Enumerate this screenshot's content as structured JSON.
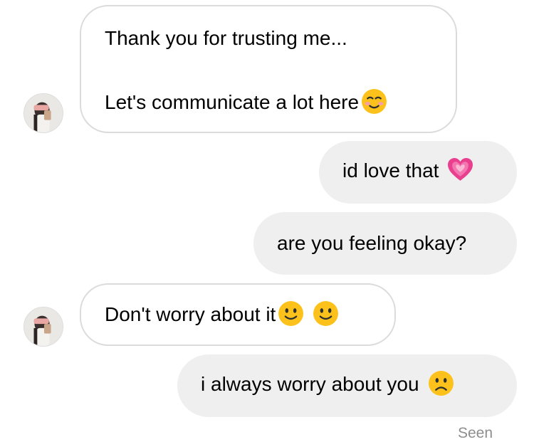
{
  "conversation": {
    "messages": [
      {
        "from": "them",
        "lines": [
          "Thank you for trusting me...",
          "Let's communicate a lot here"
        ],
        "emojis": [
          "smiling-face-icon"
        ]
      },
      {
        "from": "me",
        "text": "id love that",
        "emojis": [
          "growing-heart-icon"
        ]
      },
      {
        "from": "me",
        "text": "are you feeling okay?",
        "emojis": []
      },
      {
        "from": "them",
        "text": "Don't worry about it",
        "emojis": [
          "slightly-smiling-face-icon",
          "slightly-smiling-face-icon"
        ]
      },
      {
        "from": "me",
        "text": "i always worry about you",
        "emojis": [
          "frowning-face-icon"
        ]
      }
    ],
    "status": "Seen"
  },
  "colors": {
    "incoming_bubble": "#ffffff",
    "incoming_border": "#dbdbdb",
    "outgoing_bubble": "#efefef",
    "status_text": "#8e8e8e",
    "heart": "#e83f8f",
    "emoji_yellow": "#fcc21b"
  }
}
